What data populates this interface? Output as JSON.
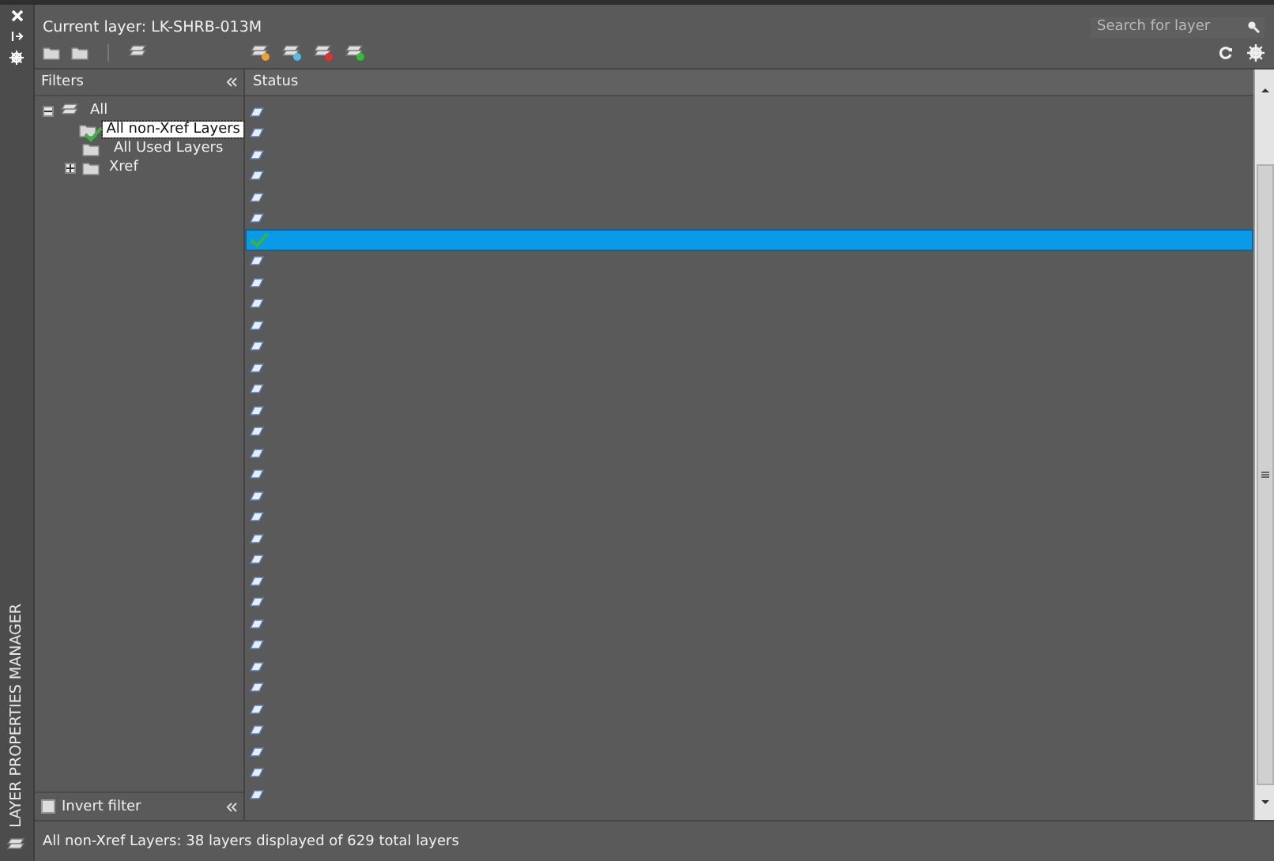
{
  "palette": {
    "title": "LAYER PROPERTIES MANAGER"
  },
  "header": {
    "current_layer": "Current layer: LK-SHRB-013M",
    "search": {
      "placeholder": "Search for layer"
    }
  },
  "filters": {
    "title": "Filters",
    "tree": [
      {
        "label": "All",
        "expanded": true,
        "selected": false,
        "children": [
          {
            "label": "All non-Xref Layers",
            "selected": true,
            "current": true
          },
          {
            "label": "All Used Layers",
            "selected": false,
            "current": false
          },
          {
            "label": "Xref",
            "selected": false,
            "expanded": false,
            "current": false
          }
        ]
      }
    ],
    "invert_filter": {
      "label": "Invert filter",
      "checked": false
    }
  },
  "table": {
    "columns": [
      "Status"
    ],
    "rows": [
      {
        "kind": "layer",
        "selected": false
      },
      {
        "kind": "layer",
        "selected": false
      },
      {
        "kind": "layer",
        "selected": false
      },
      {
        "kind": "layer",
        "selected": false
      },
      {
        "kind": "layer",
        "selected": false
      },
      {
        "kind": "layer",
        "selected": false
      },
      {
        "kind": "current",
        "selected": true
      },
      {
        "kind": "layer",
        "selected": false
      },
      {
        "kind": "layer",
        "selected": false
      },
      {
        "kind": "layer",
        "selected": false
      },
      {
        "kind": "layer",
        "selected": false
      },
      {
        "kind": "layer",
        "selected": false
      },
      {
        "kind": "layer",
        "selected": false
      },
      {
        "kind": "layer",
        "selected": false
      },
      {
        "kind": "layer",
        "selected": false
      },
      {
        "kind": "layer",
        "selected": false
      },
      {
        "kind": "layer",
        "selected": false
      },
      {
        "kind": "layer",
        "selected": false
      },
      {
        "kind": "layer",
        "selected": false
      },
      {
        "kind": "layer",
        "selected": false
      },
      {
        "kind": "layer",
        "selected": false
      },
      {
        "kind": "layer",
        "selected": false
      },
      {
        "kind": "layer",
        "selected": false
      },
      {
        "kind": "layer",
        "selected": false
      },
      {
        "kind": "layer",
        "selected": false
      },
      {
        "kind": "layer",
        "selected": false
      },
      {
        "kind": "layer",
        "selected": false
      },
      {
        "kind": "layer",
        "selected": false
      },
      {
        "kind": "layer",
        "selected": false
      },
      {
        "kind": "layer",
        "selected": false
      },
      {
        "kind": "layer",
        "selected": false
      },
      {
        "kind": "layer",
        "selected": false
      },
      {
        "kind": "layer",
        "selected": false
      }
    ]
  },
  "status_bar": "All non-Xref Layers: 38 layers displayed of 629 total layers"
}
